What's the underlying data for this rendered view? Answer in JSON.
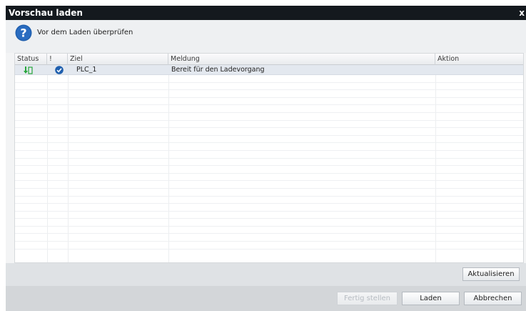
{
  "window": {
    "title": "Vorschau laden",
    "close_glyph": "x"
  },
  "header": {
    "icon": "question-icon",
    "text": "Vor dem Laden überprüfen"
  },
  "table": {
    "columns": [
      "Status",
      "!",
      "Ziel",
      "Meldung",
      "Aktion"
    ],
    "rows": [
      {
        "status_icon": "download-status-icon",
        "check_icon": "check-circle-icon",
        "target": "PLC_1",
        "message": "Bereit für den Ladevorgang",
        "action": ""
      }
    ]
  },
  "buttons": {
    "refresh": "Aktualisieren",
    "finish": "Fertig stellen",
    "load": "Laden",
    "cancel": "Abbrechen"
  },
  "colors": {
    "titlebar": "#14191e",
    "accent_green": "#27a63b",
    "accent_blue": "#1f5fae",
    "row_selected": "#e3e8ef"
  }
}
